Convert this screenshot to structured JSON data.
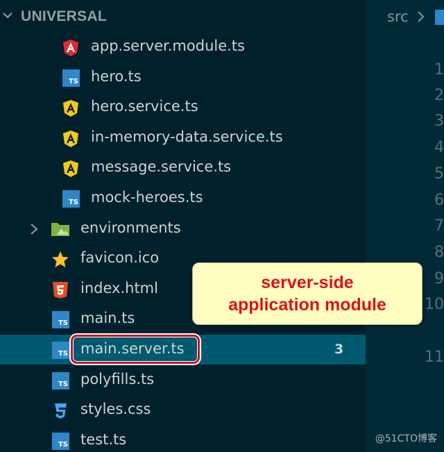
{
  "explorer": {
    "section_title": "UNIVERSAL",
    "items": [
      {
        "label": "app.server.module.ts",
        "icon": "angular-red-icon"
      },
      {
        "label": "hero.ts",
        "icon": "typescript-icon"
      },
      {
        "label": "hero.service.ts",
        "icon": "angular-yellow-icon"
      },
      {
        "label": "in-memory-data.service.ts",
        "icon": "angular-yellow-icon"
      },
      {
        "label": "message.service.ts",
        "icon": "angular-yellow-icon"
      },
      {
        "label": "mock-heroes.ts",
        "icon": "typescript-icon"
      },
      {
        "label": "environments",
        "icon": "folder-icon"
      },
      {
        "label": "favicon.ico",
        "icon": "star-icon"
      },
      {
        "label": "index.html",
        "icon": "html5-icon"
      },
      {
        "label": "main.ts",
        "icon": "typescript-icon"
      },
      {
        "label": "main.server.ts",
        "icon": "typescript-icon",
        "badge": "3"
      },
      {
        "label": "polyfills.ts",
        "icon": "typescript-icon"
      },
      {
        "label": "styles.css",
        "icon": "css3-icon"
      },
      {
        "label": "test.ts",
        "icon": "typescript-icon"
      }
    ]
  },
  "callout": {
    "line1": "server-side",
    "line2": "application module"
  },
  "editor": {
    "breadcrumb": "src",
    "line_numbers": [
      "1",
      "2",
      "3",
      "4",
      "5",
      "6",
      "7",
      "8",
      "9",
      "10",
      "11"
    ]
  },
  "watermark": "@51CTO博客",
  "colors": {
    "sidebar_bg": "#00212b",
    "editor_bg": "#002b36",
    "selection_bg": "#005a6f",
    "callout_bg": "#ffffc2",
    "callout_text": "#e0111b",
    "highlight_border": "#c0182c"
  }
}
